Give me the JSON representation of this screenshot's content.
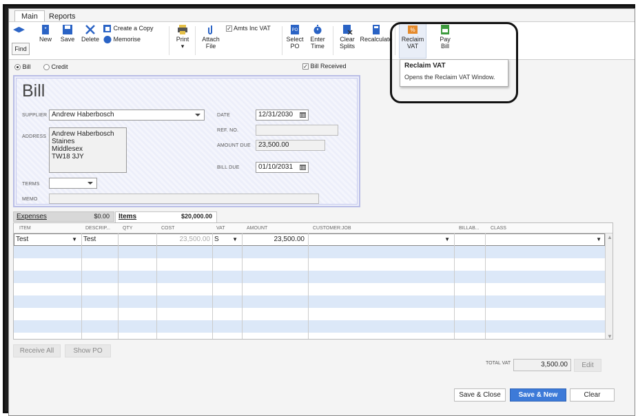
{
  "tabs": [
    {
      "label": "Main"
    },
    {
      "label": "Reports"
    }
  ],
  "toolbar": {
    "find": "Find",
    "new": "New",
    "save": "Save",
    "delete": "Delete",
    "create_copy": "Create a Copy",
    "memorise": "Memorise",
    "print": "Print",
    "attach_file": "Attach File",
    "amts_inc_vat": "Amts Inc VAT",
    "select_po": "Select PO",
    "enter_time": "Enter Time",
    "clear_splits": "Clear Splits",
    "recalculate": "Recalculate",
    "reclaim_vat": "Reclaim VAT",
    "pay_bill": "Pay Bill"
  },
  "tooltip": {
    "title": "Reclaim VAT",
    "text": "Opens the Reclaim VAT Window."
  },
  "form_type": {
    "bill": "Bill",
    "credit": "Credit",
    "selected": "Bill"
  },
  "bill_received": "Bill Received",
  "bill": {
    "heading": "Bill",
    "supplier_label": "SUPPLIER",
    "supplier": "Andrew Haberbosch",
    "address_label": "ADDRESS",
    "address": [
      "Andrew Haberbosch",
      "Staines",
      "Middlesex",
      "TW18 3JY"
    ],
    "terms_label": "TERMS",
    "memo_label": "MEMO",
    "date_label": "DATE",
    "date": "12/31/2030",
    "ref_label": "REF. NO.",
    "amount_due_label": "AMOUNT DUE",
    "amount_due": "23,500.00",
    "bill_due_label": "BILL DUE",
    "bill_due": "01/10/2031"
  },
  "detail_tabs": {
    "expenses": "Expenses",
    "expenses_amount": "$0.00",
    "items": "Items",
    "items_amount": "$20,000.00"
  },
  "grid": {
    "columns": [
      "ITEM",
      "DESCRIP...",
      "QTY",
      "COST",
      "VAT",
      "AMOUNT",
      "CUSTOMER:JOB",
      "BILLAB...",
      "CLASS"
    ],
    "row": {
      "item": "Test",
      "description": "Test",
      "qty": "",
      "cost": "23,500.00",
      "vat": "S",
      "amount": "23,500.00"
    }
  },
  "buttons": {
    "receive_all": "Receive All",
    "show_po": "Show PO",
    "save_close": "Save & Close",
    "save_new": "Save & New",
    "clear": "Clear",
    "edit": "Edit"
  },
  "total_vat_label": "TOTAL VAT",
  "total_vat": "3,500.00",
  "colors": {
    "accent": "#3d7ad8",
    "row_stripe": "#dce8f8",
    "form_bg": "#eef0fa"
  }
}
